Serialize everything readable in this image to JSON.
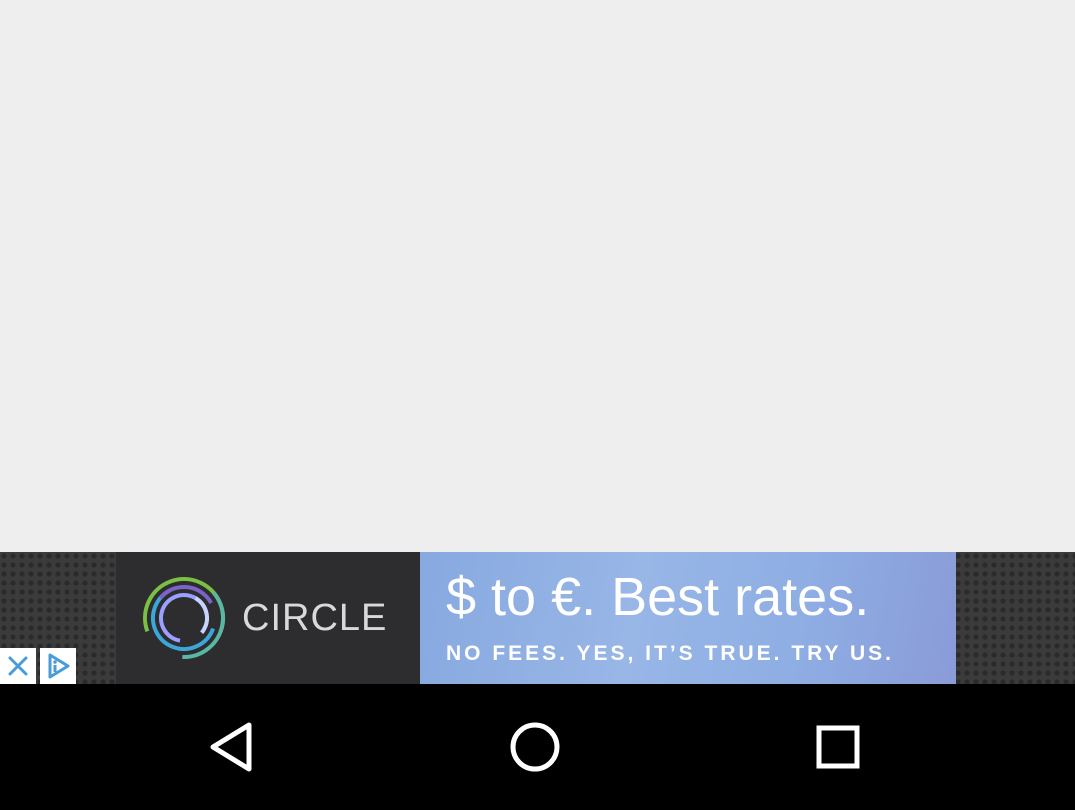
{
  "ad": {
    "brand": "CIRCLE",
    "headline": "$ to €. Best rates.",
    "subline": "NO FEES. YES, IT’S TRUE. TRY US."
  },
  "icons": {
    "ad_close": "close-icon",
    "ad_choices": "ad-choices-icon",
    "back": "back-triangle-icon",
    "home": "home-circle-icon",
    "recents": "recents-square-icon"
  },
  "colors": {
    "background": "#eeeeee",
    "ad_blue": "#8eaee4",
    "ad_dark": "#2d2d2f",
    "navbar": "#000000",
    "ad_control_blue": "#4a9bd8"
  }
}
